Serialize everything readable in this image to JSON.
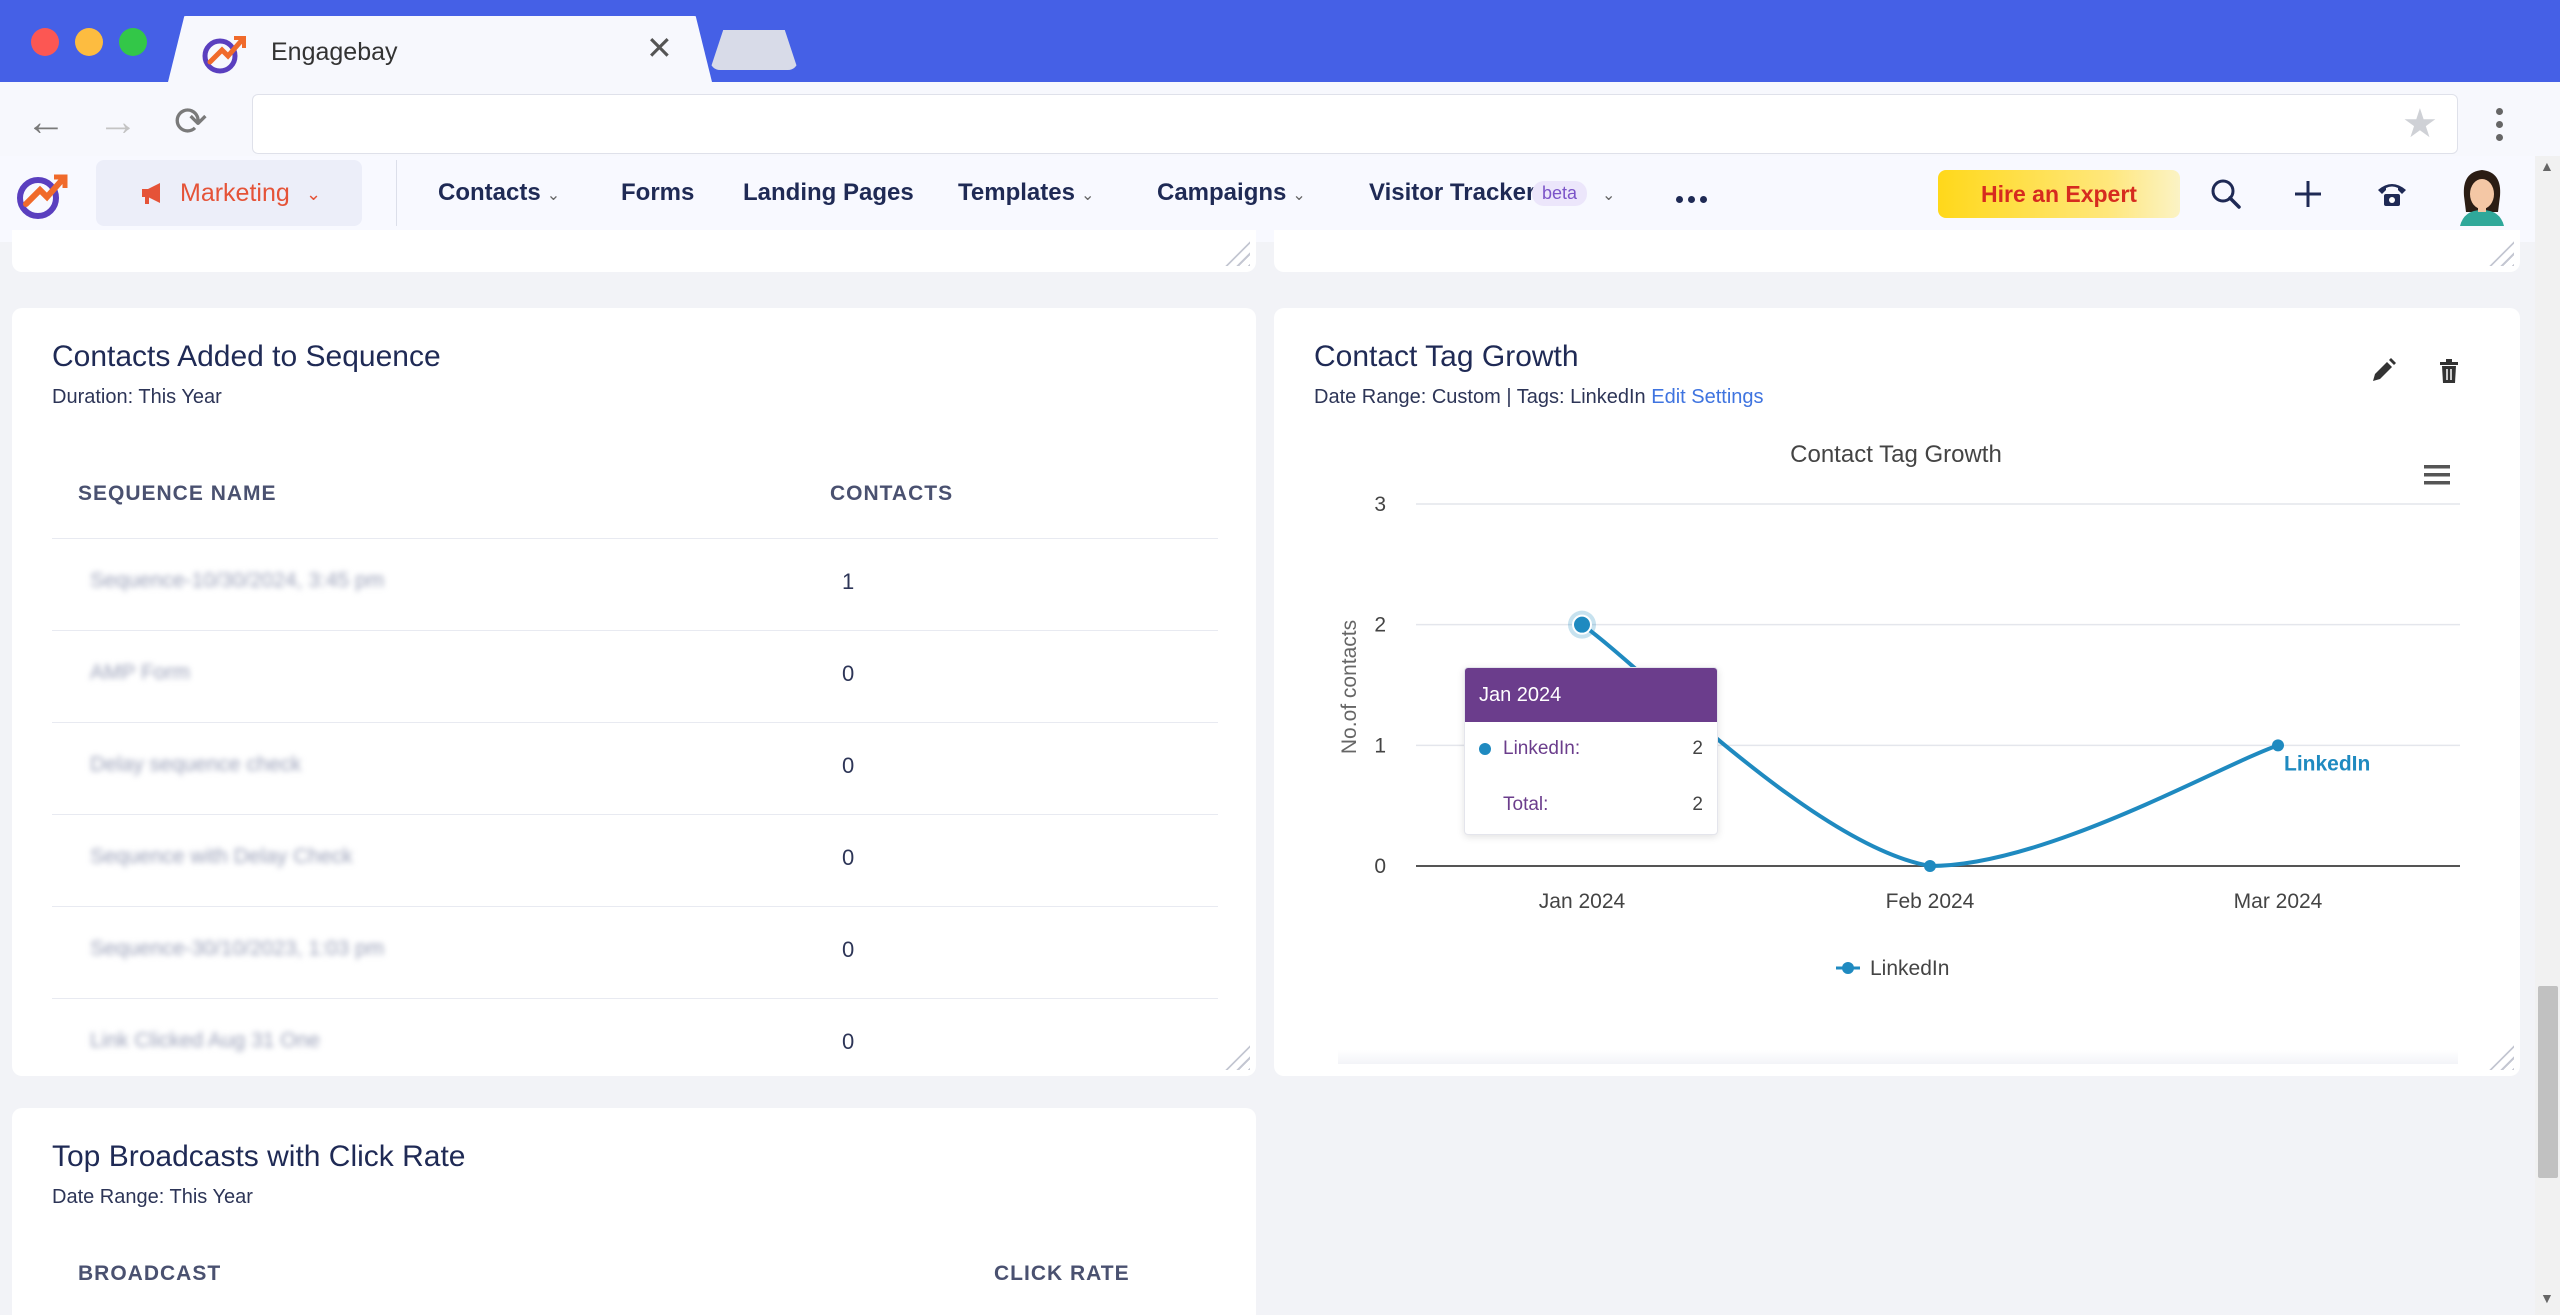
{
  "browser": {
    "tab_title": "Engagebay",
    "tab_close": "✕",
    "nav_back": "←",
    "nav_forward": "→",
    "nav_reload": "⟳",
    "star": "★"
  },
  "header": {
    "module": "Marketing",
    "nav": [
      {
        "label": "Contacts",
        "dropdown": true
      },
      {
        "label": "Forms",
        "dropdown": false
      },
      {
        "label": "Landing Pages",
        "dropdown": false
      },
      {
        "label": "Templates",
        "dropdown": true
      },
      {
        "label": "Campaigns",
        "dropdown": true
      },
      {
        "label": "Visitor Tracker",
        "dropdown": true
      }
    ],
    "beta_badge": "beta",
    "hire_button": "Hire an Expert",
    "chevron": "⌄"
  },
  "sequence_card": {
    "title": "Contacts Added to Sequence",
    "subtitle": "Duration: This Year",
    "columns": [
      "SEQUENCE NAME",
      "CONTACTS"
    ],
    "rows": [
      {
        "name": "Sequence-10/30/2024, 3:45 pm",
        "contacts": "1"
      },
      {
        "name": "AMP Form",
        "contacts": "0"
      },
      {
        "name": "Delay sequence check",
        "contacts": "0"
      },
      {
        "name": "Sequence with Delay Check",
        "contacts": "0"
      },
      {
        "name": "Sequence-30/10/2023, 1:03 pm",
        "contacts": "0"
      },
      {
        "name": "Link Clicked Aug 31 One",
        "contacts": "0"
      }
    ]
  },
  "broadcast_card": {
    "title": "Top Broadcasts with Click Rate",
    "subtitle": "Date Range: This Year",
    "columns": [
      "BROADCAST",
      "CLICK RATE"
    ]
  },
  "tag_card": {
    "title": "Contact Tag Growth",
    "subtitle_prefix": "Date Range: Custom | Tags: LinkedIn",
    "subtitle_link": "Edit Settings"
  },
  "chart_data": {
    "type": "line",
    "title": "Contact Tag Growth",
    "xlabel": "",
    "ylabel": "No.of contacts",
    "categories": [
      "Jan 2024",
      "Feb 2024",
      "Mar 2024"
    ],
    "series": [
      {
        "name": "LinkedIn",
        "values": [
          2,
          0,
          1
        ],
        "color": "#1f8ac0"
      }
    ],
    "ylim": [
      0,
      3
    ],
    "yticks": [
      0,
      1,
      2,
      3
    ],
    "grid": true,
    "legend": "bottom-center",
    "end_label": "LinkedIn",
    "tooltip": {
      "header": "Jan 2024",
      "rows": [
        {
          "label": "LinkedIn:",
          "value": "2"
        },
        {
          "label": "Total:",
          "value": "2"
        }
      ]
    }
  }
}
